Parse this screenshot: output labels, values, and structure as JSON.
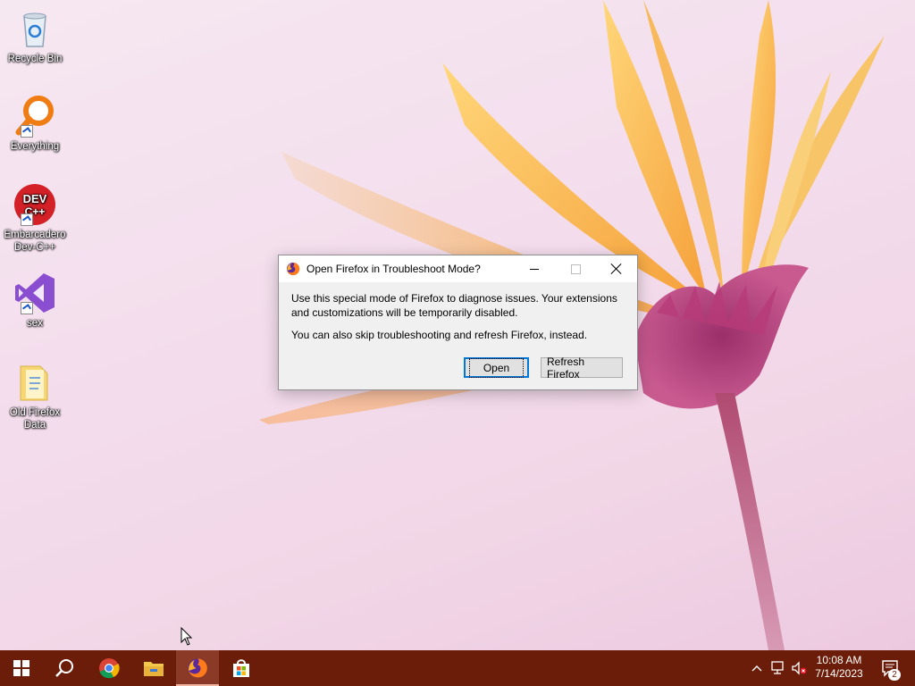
{
  "desktop": {
    "icons": [
      {
        "label": "Recycle Bin",
        "icon": "recycle-bin-icon"
      },
      {
        "label": "Everything",
        "icon": "everything-search-icon"
      },
      {
        "label": "Embarcadero Dev-C++",
        "icon": "devcpp-icon"
      },
      {
        "label": "sex",
        "icon": "visual-studio-icon"
      },
      {
        "label": "Old Firefox Data",
        "icon": "folder-icon"
      }
    ]
  },
  "dialog": {
    "title": "Open Firefox in Troubleshoot Mode?",
    "message1": "Use this special mode of Firefox to diagnose issues. Your extensions and customizations will be temporarily disabled.",
    "message2": "You can also skip troubleshooting and refresh Firefox, instead.",
    "open_label": "Open",
    "refresh_label": "Refresh Firefox"
  },
  "taskbar": {
    "items": [
      "start",
      "search",
      "chrome",
      "file-explorer",
      "firefox",
      "microsoft-store"
    ],
    "active_item": "firefox",
    "time": "10:08 AM",
    "date": "7/14/2023",
    "notification_count": "2"
  },
  "colors": {
    "taskbar": "#6b1d09",
    "accent": "#0078d7"
  }
}
